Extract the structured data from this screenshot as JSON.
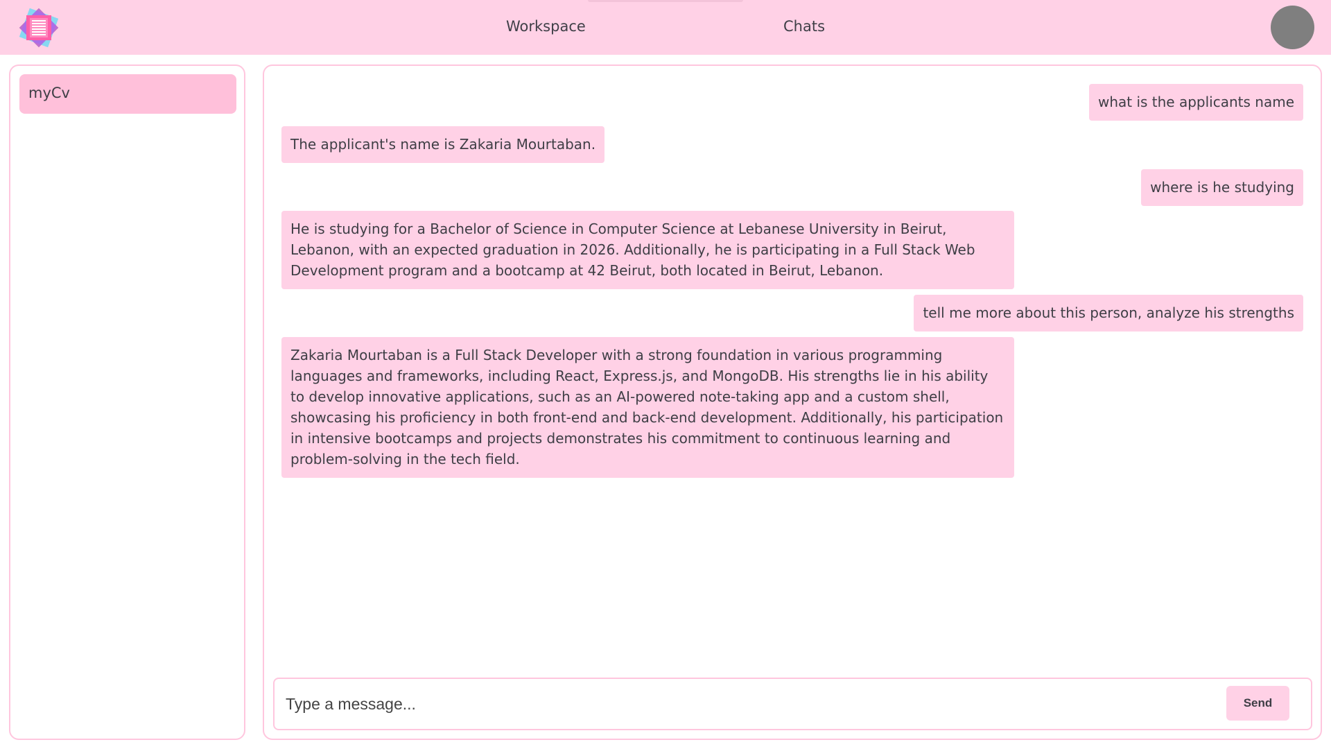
{
  "header": {
    "logo_icon": "notes-logo-icon",
    "nav": [
      {
        "label": "Workspace"
      },
      {
        "label": "Chats"
      }
    ],
    "avatar_icon": "user-avatar-icon"
  },
  "sidebar": {
    "items": [
      {
        "label": "myCv"
      }
    ]
  },
  "chat": {
    "messages": [
      {
        "role": "user",
        "text": "what is the applicants name"
      },
      {
        "role": "assistant",
        "text": "The applicant's name is Zakaria Mourtaban."
      },
      {
        "role": "user",
        "text": "where is he studying"
      },
      {
        "role": "assistant",
        "text": "He is studying for a Bachelor of Science in Computer Science at Lebanese University in Beirut, Lebanon, with an expected graduation in 2026. Additionally, he is participating in a Full Stack Web Development program and a bootcamp at 42 Beirut, both located in Beirut, Lebanon."
      },
      {
        "role": "user",
        "text": "tell me more about this person, analyze his strengths"
      },
      {
        "role": "assistant",
        "text": "Zakaria Mourtaban is a Full Stack Developer with a strong foundation in various programming languages and frameworks, including React, Express.js, and MongoDB. His strengths lie in his ability to develop innovative applications, such as an AI-powered note-taking app and a custom shell, showcasing his proficiency in both front-end and back-end development. Additionally, his participation in intensive bootcamps and projects demonstrates his commitment to continuous learning and problem-solving in the tech field."
      }
    ]
  },
  "composer": {
    "placeholder": "Type a message...",
    "value": "",
    "send_label": "Send"
  },
  "colors": {
    "header_bg": "#ffd1e6",
    "bubble_bg": "#ffd1e6",
    "sidebar_active_bg": "#ffc0da",
    "border": "#ffc6de",
    "avatar": "#7f7f7f"
  }
}
